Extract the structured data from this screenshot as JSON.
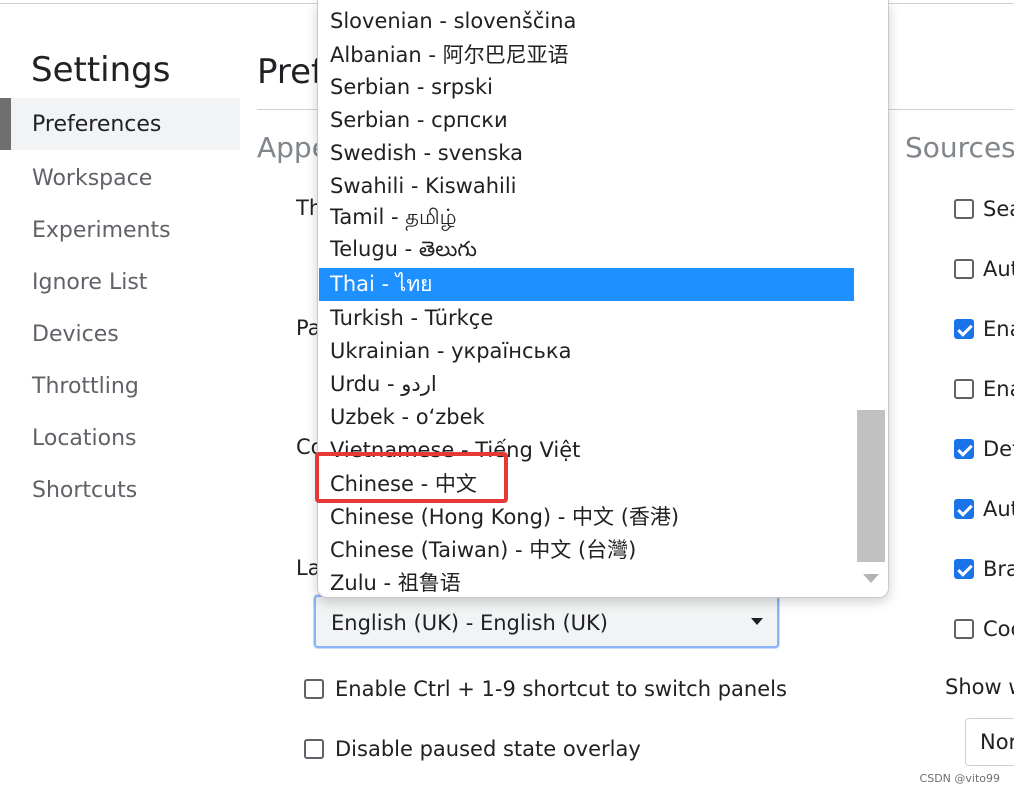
{
  "sidebar": {
    "title": "Settings",
    "items": [
      {
        "label": "Preferences"
      },
      {
        "label": "Workspace"
      },
      {
        "label": "Experiments"
      },
      {
        "label": "Ignore List"
      },
      {
        "label": "Devices"
      },
      {
        "label": "Throttling"
      },
      {
        "label": "Locations"
      },
      {
        "label": "Shortcuts"
      }
    ]
  },
  "main": {
    "title": "Pref",
    "appearance": {
      "heading": "Appe",
      "theme_label": "Th",
      "panel_label": "Pa",
      "color_label": "Co",
      "language_label": "La",
      "language_select": {
        "value": "English (UK) - English (UK)"
      },
      "checkboxes": [
        {
          "label": "Enable Ctrl + 1-9 shortcut to switch panels",
          "checked": false
        },
        {
          "label": "Disable paused state overlay",
          "checked": false
        }
      ]
    },
    "sources": {
      "heading": "Sources",
      "checkboxes": [
        {
          "label": "Sea",
          "checked": false
        },
        {
          "label": "Aut",
          "checked": false
        },
        {
          "label": "Ena",
          "checked": true
        },
        {
          "label": "Ena",
          "checked": false
        },
        {
          "label": "Det",
          "checked": true
        },
        {
          "label": "Aut",
          "checked": true
        },
        {
          "label": "Bra",
          "checked": true
        },
        {
          "label": "Coc",
          "checked": false
        }
      ],
      "show_label": "Show w",
      "show_select_value": "Nor"
    }
  },
  "dropdown": {
    "highlighted_index": 8,
    "annotated_index": 14,
    "options": [
      {
        "label": "Slovenian - slovenščina"
      },
      {
        "label": "Albanian - 阿尔巴尼亚语"
      },
      {
        "label": "Serbian - srpski"
      },
      {
        "label": "Serbian - српски"
      },
      {
        "label": "Swedish - svenska"
      },
      {
        "label": "Swahili - Kiswahili"
      },
      {
        "label": "Tamil - தமிழ்"
      },
      {
        "label": "Telugu - తెలుగు"
      },
      {
        "label": "Thai - ไทย"
      },
      {
        "label": "Turkish - Türkçe"
      },
      {
        "label": "Ukrainian - українська"
      },
      {
        "label": "Urdu - اردو"
      },
      {
        "label": "Uzbek - o‘zbek"
      },
      {
        "label": "Vietnamese - Tiếng Việt"
      },
      {
        "label": "Chinese - 中文"
      },
      {
        "label": "Chinese (Hong Kong) - 中文 (香港)"
      },
      {
        "label": "Chinese (Taiwan) - 中文 (台灣)"
      },
      {
        "label": "Zulu - 祖鲁语"
      }
    ]
  },
  "colors": {
    "highlight": "#1e90ff",
    "checkbox_checked": "#1a73e8",
    "annotation_box": "#e53935"
  },
  "watermark": "CSDN @vito99"
}
